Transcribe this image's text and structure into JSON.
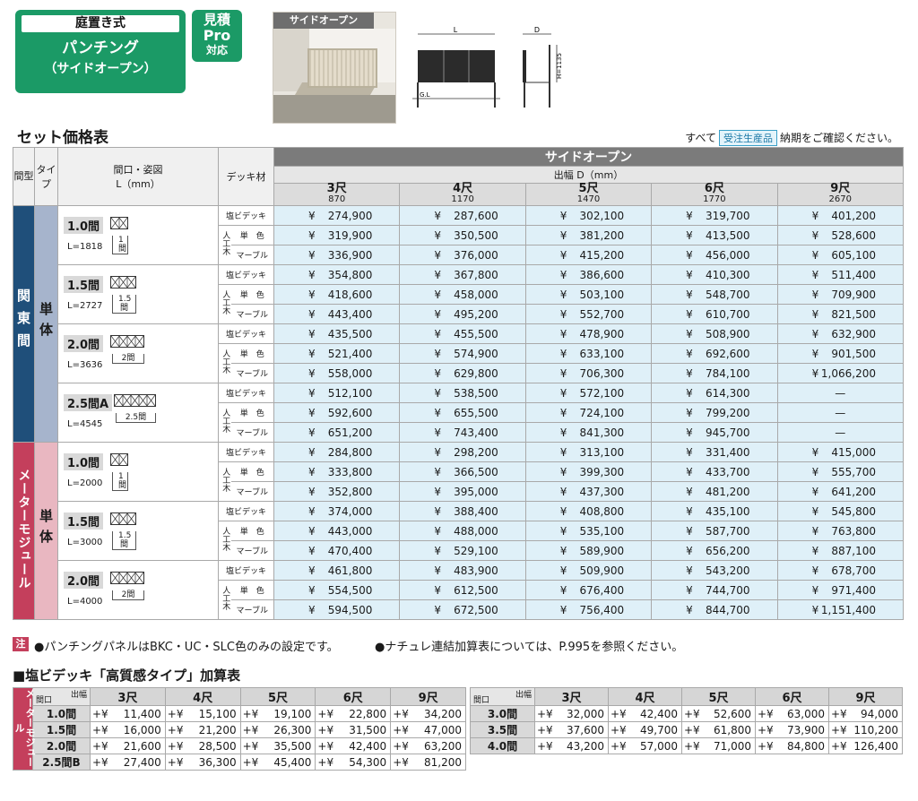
{
  "header": {
    "badge_top": "庭置き式",
    "badge_main": "パンチング",
    "badge_sub": "（サイドオープン）",
    "mitsumori": [
      "見積",
      "Pro",
      "対応"
    ],
    "photo_title": "サイドオープン",
    "diagram": {
      "L": "L",
      "D": "D",
      "H": "H=1135",
      "GL": "G.L"
    }
  },
  "section_title": "セット価格表",
  "note_right": {
    "pre": "すべて",
    "tag": "受注生産品",
    "post": "納期をご確認ください。"
  },
  "table": {
    "head": {
      "region": "間型",
      "type": "タイプ",
      "width": "間口・姿図",
      "width_unit": "L（mm）",
      "deck": "デッキ材",
      "side_open": "サイドオープン",
      "depth": "出幅 D（mm）",
      "sizes": [
        {
          "shaku": "3尺",
          "mm": "870"
        },
        {
          "shaku": "4尺",
          "mm": "1170"
        },
        {
          "shaku": "5尺",
          "mm": "1470"
        },
        {
          "shaku": "6尺",
          "mm": "1770"
        },
        {
          "shaku": "9尺",
          "mm": "2670"
        }
      ]
    },
    "deck_kinds": {
      "enbi": "塩ビデッキ",
      "jinko": "人工木",
      "tanshoku": "単　色",
      "marble": "マーブル"
    },
    "regions": [
      {
        "name": "関東間",
        "type": "単体",
        "groups": [
          {
            "ken": "1.0間",
            "len": "L=1818",
            "span": "1間",
            "rows": [
              [
                "¥ 274,900",
                "¥ 287,600",
                "¥ 302,100",
                "¥ 319,700",
                "¥ 401,200"
              ],
              [
                "¥ 319,900",
                "¥ 350,500",
                "¥ 381,200",
                "¥ 413,500",
                "¥ 528,600"
              ],
              [
                "¥ 336,900",
                "¥ 376,000",
                "¥ 415,200",
                "¥ 456,000",
                "¥ 605,100"
              ]
            ]
          },
          {
            "ken": "1.5間",
            "len": "L=2727",
            "span": "1.5間",
            "rows": [
              [
                "¥ 354,800",
                "¥ 367,800",
                "¥ 386,600",
                "¥ 410,300",
                "¥ 511,400"
              ],
              [
                "¥ 418,600",
                "¥ 458,000",
                "¥ 503,100",
                "¥ 548,700",
                "¥ 709,900"
              ],
              [
                "¥ 443,400",
                "¥ 495,200",
                "¥ 552,700",
                "¥ 610,700",
                "¥ 821,500"
              ]
            ]
          },
          {
            "ken": "2.0間",
            "len": "L=3636",
            "span": "2間",
            "rows": [
              [
                "¥ 435,500",
                "¥ 455,500",
                "¥ 478,900",
                "¥ 508,900",
                "¥ 632,900"
              ],
              [
                "¥ 521,400",
                "¥ 574,900",
                "¥ 633,100",
                "¥ 692,600",
                "¥ 901,500"
              ],
              [
                "¥ 558,000",
                "¥ 629,800",
                "¥ 706,300",
                "¥ 784,100",
                "¥1,066,200"
              ]
            ]
          },
          {
            "ken": "2.5間A",
            "len": "L=4545",
            "span": "2.5間",
            "rows": [
              [
                "¥ 512,100",
                "¥ 538,500",
                "¥ 572,100",
                "¥ 614,300",
                "—"
              ],
              [
                "¥ 592,600",
                "¥ 655,500",
                "¥ 724,100",
                "¥ 799,200",
                "—"
              ],
              [
                "¥ 651,200",
                "¥ 743,400",
                "¥ 841,300",
                "¥ 945,700",
                "—"
              ]
            ]
          }
        ]
      },
      {
        "name": "メーターモジュール",
        "type": "単体",
        "groups": [
          {
            "ken": "1.0間",
            "len": "L=2000",
            "span": "1間",
            "rows": [
              [
                "¥ 284,800",
                "¥ 298,200",
                "¥ 313,100",
                "¥ 331,400",
                "¥ 415,000"
              ],
              [
                "¥ 333,800",
                "¥ 366,500",
                "¥ 399,300",
                "¥ 433,700",
                "¥ 555,700"
              ],
              [
                "¥ 352,800",
                "¥ 395,000",
                "¥ 437,300",
                "¥ 481,200",
                "¥ 641,200"
              ]
            ]
          },
          {
            "ken": "1.5間",
            "len": "L=3000",
            "span": "1.5間",
            "rows": [
              [
                "¥ 374,000",
                "¥ 388,400",
                "¥ 408,800",
                "¥ 435,100",
                "¥ 545,800"
              ],
              [
                "¥ 443,000",
                "¥ 488,000",
                "¥ 535,100",
                "¥ 587,700",
                "¥ 763,800"
              ],
              [
                "¥ 470,400",
                "¥ 529,100",
                "¥ 589,900",
                "¥ 656,200",
                "¥ 887,100"
              ]
            ]
          },
          {
            "ken": "2.0間",
            "len": "L=4000",
            "span": "2間",
            "rows": [
              [
                "¥ 461,800",
                "¥ 483,900",
                "¥ 509,900",
                "¥ 543,200",
                "¥ 678,700"
              ],
              [
                "¥ 554,500",
                "¥ 612,500",
                "¥ 676,400",
                "¥ 744,700",
                "¥ 971,400"
              ],
              [
                "¥ 594,500",
                "¥ 672,500",
                "¥ 756,400",
                "¥ 844,700",
                "¥1,151,400"
              ]
            ]
          }
        ]
      }
    ]
  },
  "notes": {
    "chu": "注",
    "n1": "●パンチングパネルはBKC・UC・SLC色のみの設定です。",
    "n2": "●ナチュレ連結加算表については、P.995を参照ください。"
  },
  "add_title": "■塩ビデッキ「高質感タイプ」加算表",
  "add_table": {
    "side": "メーターモジュール",
    "corner_top": "出幅",
    "corner_bottom": "間口",
    "sizes": [
      "3尺",
      "4尺",
      "5尺",
      "6尺",
      "9尺"
    ],
    "left_rows": [
      {
        "ken": "1.0間",
        "vals": [
          "11,400",
          "15,100",
          "19,100",
          "22,800",
          "34,200"
        ]
      },
      {
        "ken": "1.5間",
        "vals": [
          "16,000",
          "21,200",
          "26,300",
          "31,500",
          "47,000"
        ]
      },
      {
        "ken": "2.0間",
        "vals": [
          "21,600",
          "28,500",
          "35,500",
          "42,400",
          "63,200"
        ]
      },
      {
        "ken": "2.5間B",
        "vals": [
          "27,400",
          "36,300",
          "45,400",
          "54,300",
          "81,200"
        ]
      }
    ],
    "right_rows": [
      {
        "ken": "3.0間",
        "vals": [
          "32,000",
          "42,400",
          "52,600",
          "63,000",
          "94,000"
        ]
      },
      {
        "ken": "3.5間",
        "vals": [
          "37,600",
          "49,700",
          "61,800",
          "73,900",
          "110,200"
        ]
      },
      {
        "ken": "4.0間",
        "vals": [
          "43,200",
          "57,000",
          "71,000",
          "84,800",
          "126,400"
        ]
      }
    ],
    "prefix": "+¥"
  }
}
